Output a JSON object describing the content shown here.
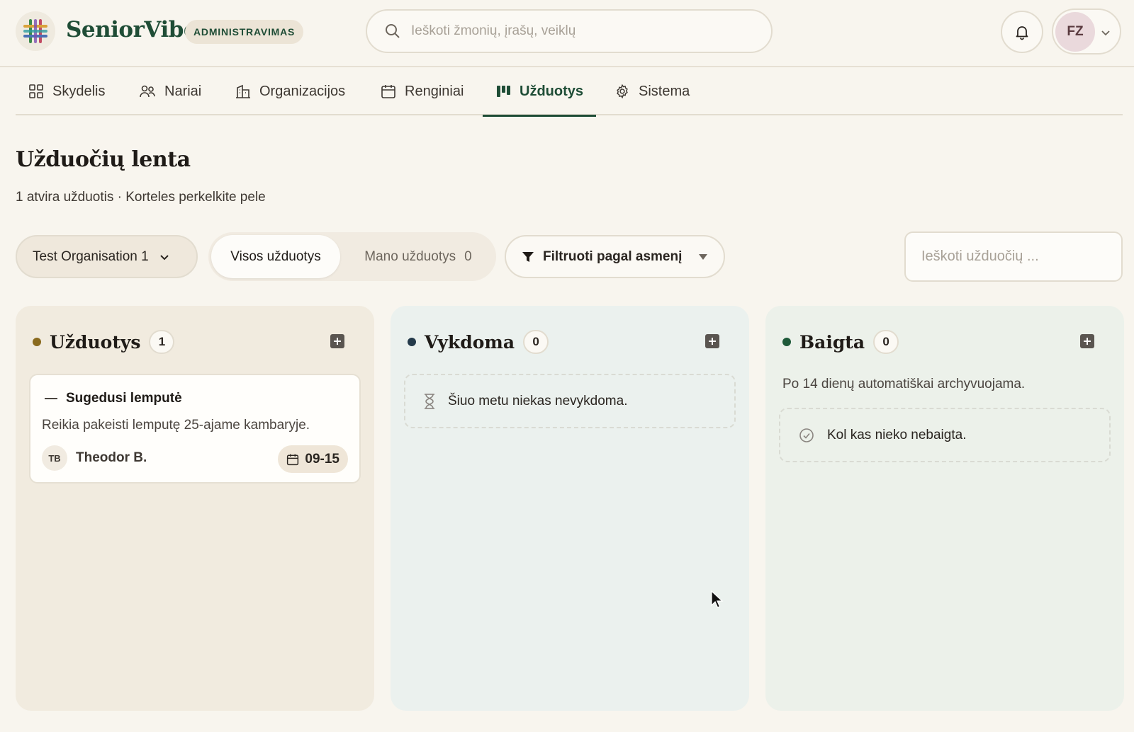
{
  "header": {
    "brand": "SeniorVibe",
    "badge": "ADMINISTRAVIMAS",
    "search_placeholder": "Ieškoti žmonių, įrašų, veiklų",
    "user_initials": "FZ"
  },
  "nav": {
    "items": [
      {
        "label": "Skydelis",
        "icon": "dashboard-grid-icon"
      },
      {
        "label": "Nariai",
        "icon": "members-icon"
      },
      {
        "label": "Organizacijos",
        "icon": "building-icon"
      },
      {
        "label": "Renginiai",
        "icon": "calendar-icon"
      },
      {
        "label": "Užduotys",
        "icon": "kanban-icon",
        "active": true
      },
      {
        "label": "Sistema",
        "icon": "gear-icon"
      }
    ]
  },
  "page": {
    "title": "Užduočių lenta",
    "subtitle": "1 atvira užduotis · Korteles perkelkite pele"
  },
  "toolbar": {
    "organisation": "Test Organisation 1",
    "all_tasks": "Visos užduotys",
    "my_tasks": "Mano užduotys",
    "my_tasks_count": "0",
    "filter_person": "Filtruoti pagal asmenį",
    "task_search_placeholder": "Ieškoti užduočių ..."
  },
  "columns": [
    {
      "title": "Užduotys",
      "count": "1",
      "dot_color": "#8a6a1e",
      "cards": [
        {
          "title": "Sugedusi lemputė",
          "description": "Reikia pakeisti lemputę 25-ajame kambaryje.",
          "assignee_initials": "TB",
          "assignee": "Theodor B.",
          "due": "09-15"
        }
      ]
    },
    {
      "title": "Vykdoma",
      "count": "0",
      "dot_color": "#243a4a",
      "empty_text": "Šiuo metu niekas nevykdoma."
    },
    {
      "title": "Baigta",
      "count": "0",
      "dot_color": "#1f5a3a",
      "note": "Po 14 dienų automatiškai archyvuojama.",
      "empty_text": "Kol kas nieko nebaigta."
    }
  ],
  "colors": {
    "brand_green": "#1f4d36",
    "background": "#f8f5ee"
  }
}
